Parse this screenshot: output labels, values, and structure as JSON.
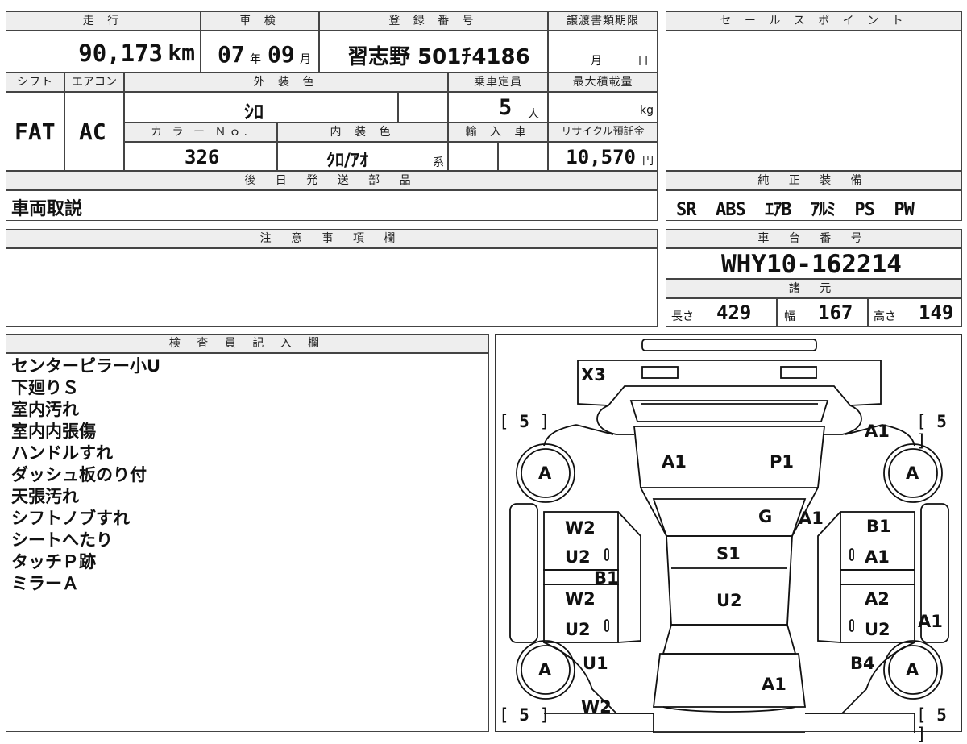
{
  "sheet": {
    "mileage": {
      "label": "走 行",
      "value": "90,173",
      "unit": "km"
    },
    "inspection": {
      "label": "車 検",
      "year": "07",
      "year_unit": "年",
      "month": "09",
      "month_unit": "月"
    },
    "registration": {
      "label": "登 録 番 号",
      "value": "習志野 501ﾁ4186"
    },
    "transfer_deadline": {
      "label": "譲渡書類期限",
      "month_unit": "月",
      "day_unit": "日"
    },
    "sales_point": {
      "label": "セ ー ル ス ポ イ ン ト",
      "value": ""
    },
    "shift": {
      "label": "シフト",
      "value": "FAT"
    },
    "aircon": {
      "label": "エアコン",
      "value": "AC"
    },
    "exterior_color": {
      "label": "外 装 色",
      "value": "ｼﾛ"
    },
    "capacity": {
      "label": "乗車定員",
      "value": "5",
      "unit": "人"
    },
    "max_load": {
      "label": "最大積載量",
      "unit": "kg"
    },
    "color_no": {
      "label": "カ ラ ー Ｎｏ.",
      "value": "326"
    },
    "interior_color": {
      "label": "内 装 色",
      "value": "ｸﾛ/ｱｵ",
      "suffix": "系"
    },
    "import": {
      "label": "輸 入 車"
    },
    "recycle_fee": {
      "label": "リサイクル預託金",
      "value": "10,570",
      "unit": "円"
    },
    "later_parts": {
      "label": "後 日 発 送 部 品",
      "value": "車両取説"
    },
    "genuine_equipment": {
      "label": "純 正 装 備",
      "value": "SR  ABS  ｴｱB  ｱﾙﾐ  PS  PW"
    },
    "caution": {
      "label": "注 意 事 項 欄",
      "value": ""
    },
    "chassis_no": {
      "label": "車 台 番 号",
      "value": "WHY10-162214"
    },
    "specs": {
      "label": "諸 元",
      "length_label": "長さ",
      "length": "429",
      "width_label": "幅",
      "width": "167",
      "height_label": "高さ",
      "height": "149"
    },
    "inspector": {
      "label": "検 査 員 記 入 欄",
      "lines": [
        "センターピラー小U",
        "下廻りＳ",
        "室内汚れ",
        "室内内張傷",
        "ハンドルすれ",
        "ダッシュ板のり付",
        "天張汚れ",
        "シフトノブすれ",
        "シートへたり",
        "タッチＰ跡",
        "ミラーＡ"
      ]
    }
  },
  "diagram": {
    "tire_bracket_value": "5",
    "tire_label": "A",
    "labels": {
      "roof_rear": "X3",
      "fender_fl": "A1",
      "hood_left": "A1",
      "hood_right": "P1",
      "windshield": "G",
      "pillar_right": "A1",
      "door_fl_1": "W2",
      "door_fl_2": "U2",
      "sill_left": "B1",
      "roof": "S1",
      "door_fr_1": "B1",
      "door_fr_2": "A1",
      "door_rl_1": "W2",
      "door_rl_2": "U2",
      "interior": "U2",
      "door_rr_1": "A2",
      "door_rr_2": "U2",
      "quarter_right": "A1",
      "rear_left": "U1",
      "rear_right": "B4",
      "trunk": "A1",
      "bumper_left": "W2"
    }
  }
}
